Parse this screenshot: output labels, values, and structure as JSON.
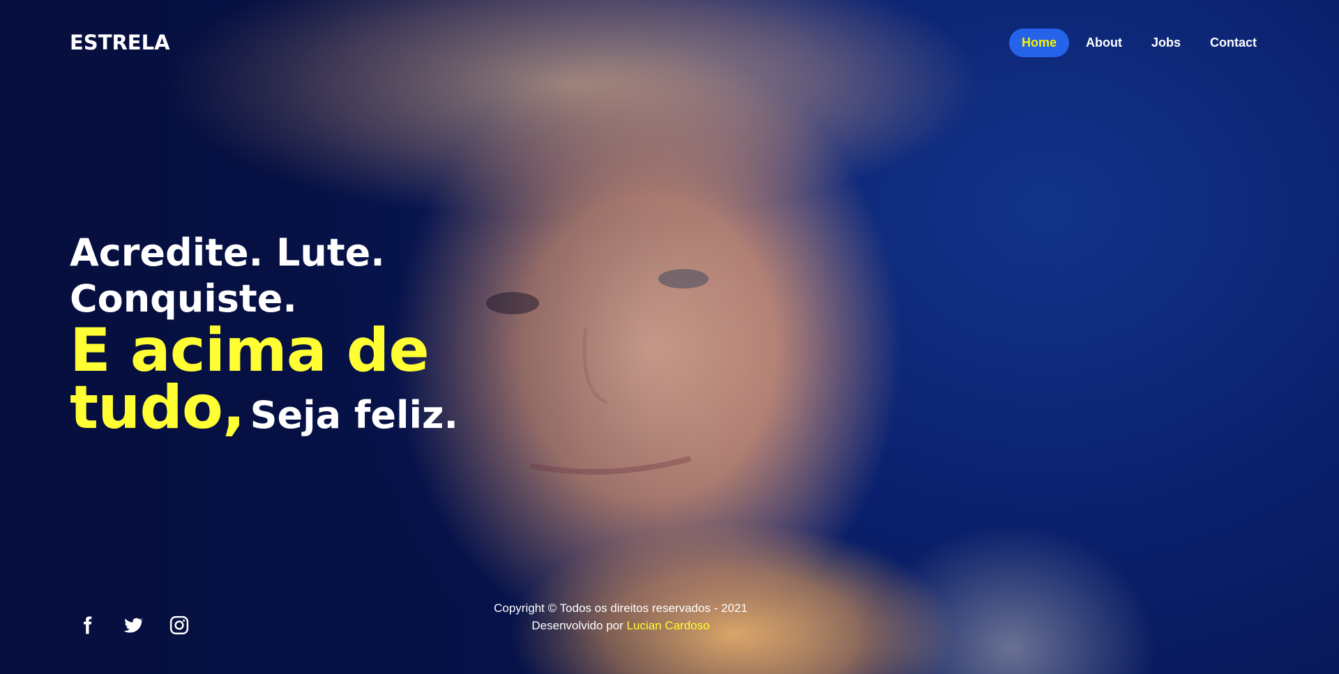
{
  "header": {
    "logo": "ESTRELA",
    "nav": [
      {
        "label": "Home",
        "active": true
      },
      {
        "label": "About",
        "active": false
      },
      {
        "label": "Jobs",
        "active": false
      },
      {
        "label": "Contact",
        "active": false
      }
    ]
  },
  "hero": {
    "line1": "Acredite. Lute.",
    "line2": "Conquiste.",
    "line3": "E acima de",
    "line4": "tudo,",
    "line4_suffix": "Seja feliz."
  },
  "social": [
    {
      "icon": "facebook-icon"
    },
    {
      "icon": "twitter-icon"
    },
    {
      "icon": "instagram-icon"
    }
  ],
  "footer": {
    "copyright": "Copyright © Todos os direitos reservados - 2021",
    "developed_by": "Desenvolvido por",
    "author": "Lucian Cardoso"
  },
  "colors": {
    "accent_yellow": "#ffff33",
    "nav_active_bg": "#2563eb",
    "background_blue": "#0b2270"
  }
}
